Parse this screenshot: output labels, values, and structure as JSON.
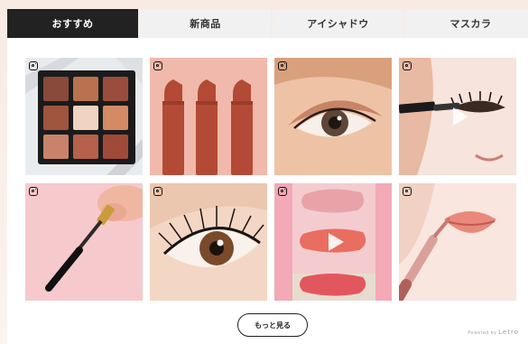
{
  "tabs": [
    {
      "label": "おすすめ",
      "active": true
    },
    {
      "label": "新商品",
      "active": false
    },
    {
      "label": "アイシャドウ",
      "active": false
    },
    {
      "label": "マスカラ",
      "active": false
    }
  ],
  "grid": {
    "tiles": [
      {
        "name": "eyeshadow-palette",
        "source_icon": "instagram-icon",
        "video": false
      },
      {
        "name": "lipsticks",
        "source_icon": "instagram-icon",
        "video": false
      },
      {
        "name": "eye-makeup",
        "source_icon": "instagram-icon",
        "video": false
      },
      {
        "name": "mascara-application",
        "source_icon": "instagram-icon",
        "video": true
      },
      {
        "name": "mascara-wand",
        "source_icon": "instagram-icon",
        "video": false
      },
      {
        "name": "eyelashes-closeup",
        "source_icon": "instagram-icon",
        "video": false
      },
      {
        "name": "color-swatches",
        "source_icon": "instagram-icon",
        "video": true
      },
      {
        "name": "lip-gloss",
        "source_icon": "instagram-icon",
        "video": false
      }
    ]
  },
  "more_button": {
    "label": "もっと見る"
  },
  "footer": {
    "powered_by": "Powered by",
    "brand": "Letro"
  },
  "colors": {
    "active_tab": "#222222",
    "inactive_tab": "#f1f1f1",
    "background": "#f7ebe4"
  }
}
